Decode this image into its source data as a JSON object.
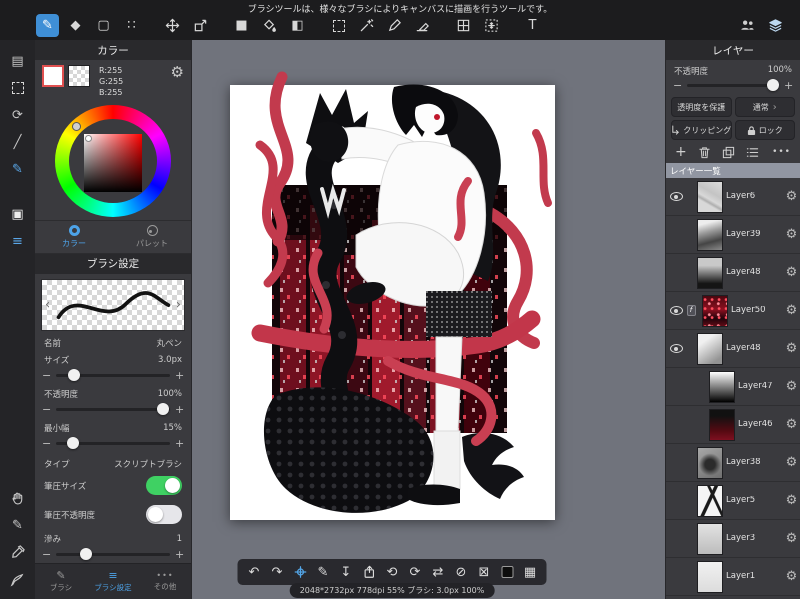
{
  "top_bar": {
    "message": "ブラシツールは、様々なブラシによりキャンバスに描画を行うツールです。"
  },
  "icons": {
    "brush": "✎",
    "eraser": "◆",
    "rect": "▢",
    "dots": "∷",
    "fill": "■",
    "gradient": "◧",
    "text": "T",
    "undo": "↶",
    "redo": "↷",
    "rotate_ccw": "⟲",
    "rotate_cw": "⟳",
    "flip": "⇄",
    "hide": "⊘",
    "clear": "⊠",
    "grid": "▦",
    "download": "↧",
    "pen": "✎",
    "gear": "⚙",
    "plus": "+",
    "minus": "−",
    "ellipsis": "•••",
    "chev_left": "‹",
    "chev_right": "›",
    "pages": "▤",
    "reset_view": "⟳",
    "ruler": "╱",
    "tone": "▣",
    "material_list": "≡",
    "clip_badge": "f"
  },
  "left_panel": {
    "color": {
      "header": "カラー",
      "r": "R:255",
      "g": "G:255",
      "b": "B:255",
      "tabs": {
        "color": "カラー",
        "palette": "パレット"
      }
    },
    "brush": {
      "header": "ブラシ設定",
      "name_label": "名前",
      "name_value": "丸ペン",
      "size_label": "サイズ",
      "size_value": "3.0px",
      "opacity_label": "不透明度",
      "opacity_value": "100%",
      "min_width_label": "最小幅",
      "min_width_value": "15%",
      "type_label": "タイプ",
      "type_value": "スクリプトブラシ",
      "pressure_size_label": "筆圧サイズ",
      "pressure_opacity_label": "筆圧不透明度",
      "bleed_label": "滲み",
      "bleed_value": "1"
    },
    "bottom_tabs": {
      "brush": "ブラシ",
      "brush_settings": "ブラシ設定",
      "other": "その他"
    }
  },
  "canvas": {
    "status": "2048*2732px 778dpi 55% ブラシ: 3.0px 100%"
  },
  "right_panel": {
    "header": "レイヤー",
    "opacity_label": "不透明度",
    "opacity_value": "100%",
    "protect_button": "透明度を保護",
    "blend_button": "通常",
    "clipping_button": "クリッピング",
    "lock_button": "ロック",
    "list_header": "レイヤー一覧",
    "layers": [
      {
        "name": "Layer6"
      },
      {
        "name": "Layer39"
      },
      {
        "name": "Layer48"
      },
      {
        "name": "Layer50"
      },
      {
        "name": "Layer48"
      },
      {
        "name": "Layer47"
      },
      {
        "name": "Layer46"
      },
      {
        "name": "Layer38"
      },
      {
        "name": "Layer5"
      },
      {
        "name": "Layer3"
      },
      {
        "name": "Layer1"
      }
    ]
  }
}
